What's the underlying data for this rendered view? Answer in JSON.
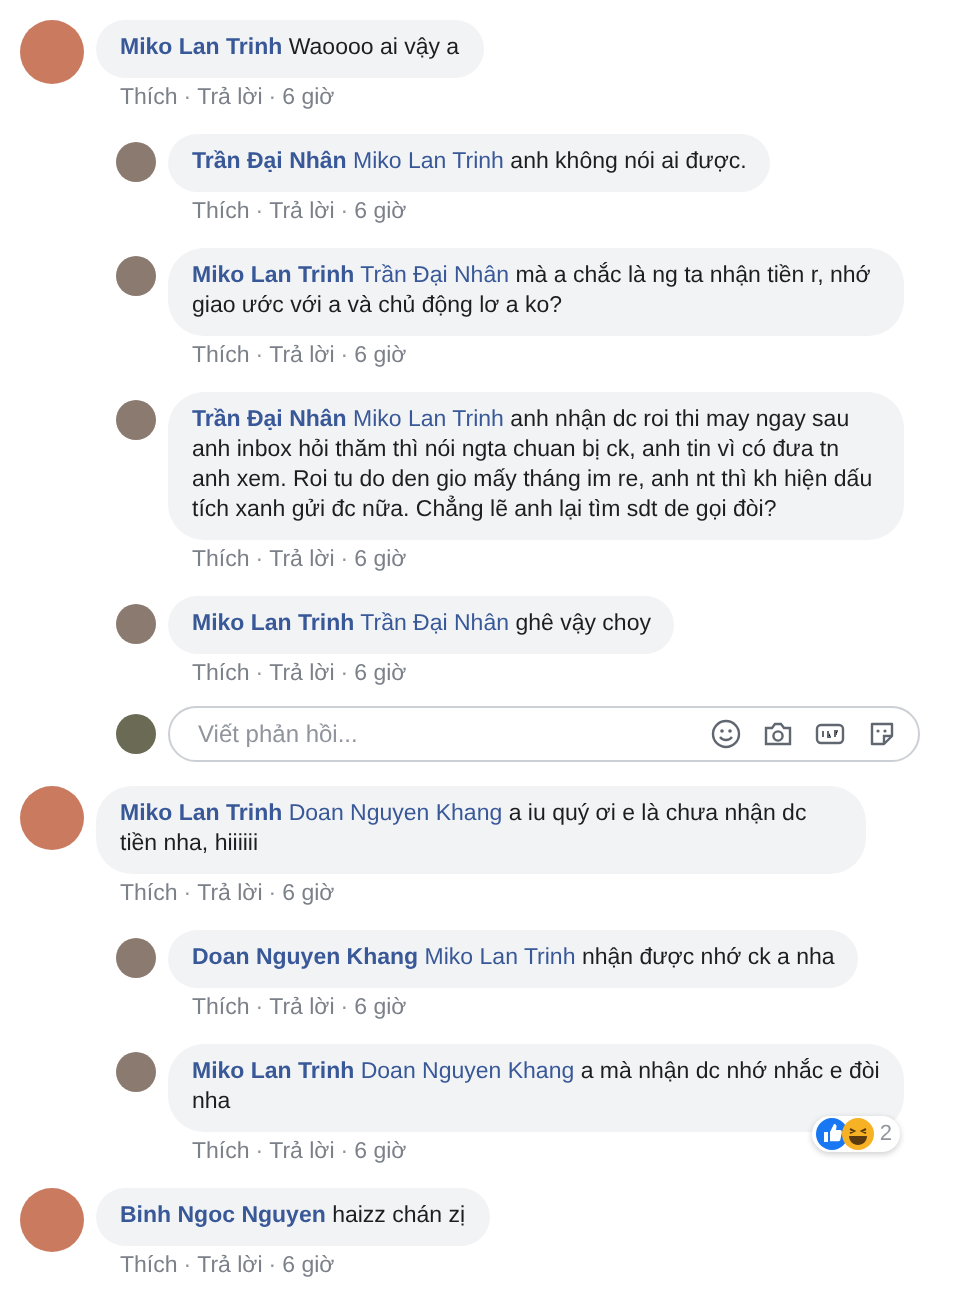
{
  "separator": "·",
  "threads": [
    {
      "comment": {
        "author": "Miko Lan Trinh",
        "text": "Waoooo ai vậy a",
        "like": "Thích",
        "reply": "Trả lời",
        "time": "6 giờ"
      },
      "replies": [
        {
          "author": "Trần Đại Nhân",
          "mention": "Miko Lan Trinh",
          "text": "anh không nói ai được.",
          "like": "Thích",
          "reply": "Trả lời",
          "time": "6 giờ"
        },
        {
          "author": "Miko Lan Trinh",
          "mention": "Trần Đại Nhân",
          "text": "mà a chắc là ng ta nhận tiền r, nhớ giao ước với a và chủ động lơ a ko?",
          "like": "Thích",
          "reply": "Trả lời",
          "time": "6 giờ"
        },
        {
          "author": "Trần Đại Nhân",
          "mention": "Miko Lan Trinh",
          "text": "anh nhận dc roi thi may ngay sau anh inbox hỏi thăm thì nói ngta chuan bị ck, anh tin vì có đưa tn anh xem. Roi tu do den gio mấy tháng im re, anh nt thì kh hiện dấu tích xanh gửi đc nữa. Chẳng lẽ anh lại tìm sdt de gọi đòi?",
          "like": "Thích",
          "reply": "Trả lời",
          "time": "6 giờ"
        },
        {
          "author": "Miko Lan Trinh",
          "mention": "Trần Đại Nhân",
          "text": "ghê vậy choy",
          "like": "Thích",
          "reply": "Trả lời",
          "time": "6 giờ"
        }
      ],
      "composer": {
        "placeholder": "Viết phản hồi..."
      }
    },
    {
      "comment": {
        "author": "Miko Lan Trinh",
        "mention": "Doan Nguyen Khang",
        "text": "a iu quý ơi e là chưa nhận dc tiền nha, hiiiiii",
        "like": "Thích",
        "reply": "Trả lời",
        "time": "6 giờ"
      },
      "replies": [
        {
          "author": "Doan Nguyen Khang",
          "mention": "Miko Lan Trinh",
          "text": "nhận được nhớ ck a nha",
          "like": "Thích",
          "reply": "Trả lời",
          "time": "6 giờ"
        },
        {
          "author": "Miko Lan Trinh",
          "mention": "Doan Nguyen Khang",
          "text": "a mà nhận dc nhớ nhắc e đòi nha",
          "like": "Thích",
          "reply": "Trả lời",
          "time": "6 giờ",
          "reactions": {
            "count": "2"
          }
        }
      ]
    },
    {
      "comment": {
        "author": "Binh Ngoc Nguyen",
        "text": "haizz chán zị",
        "like": "Thích",
        "reply": "Trả lời",
        "time": "6 giờ"
      }
    }
  ]
}
